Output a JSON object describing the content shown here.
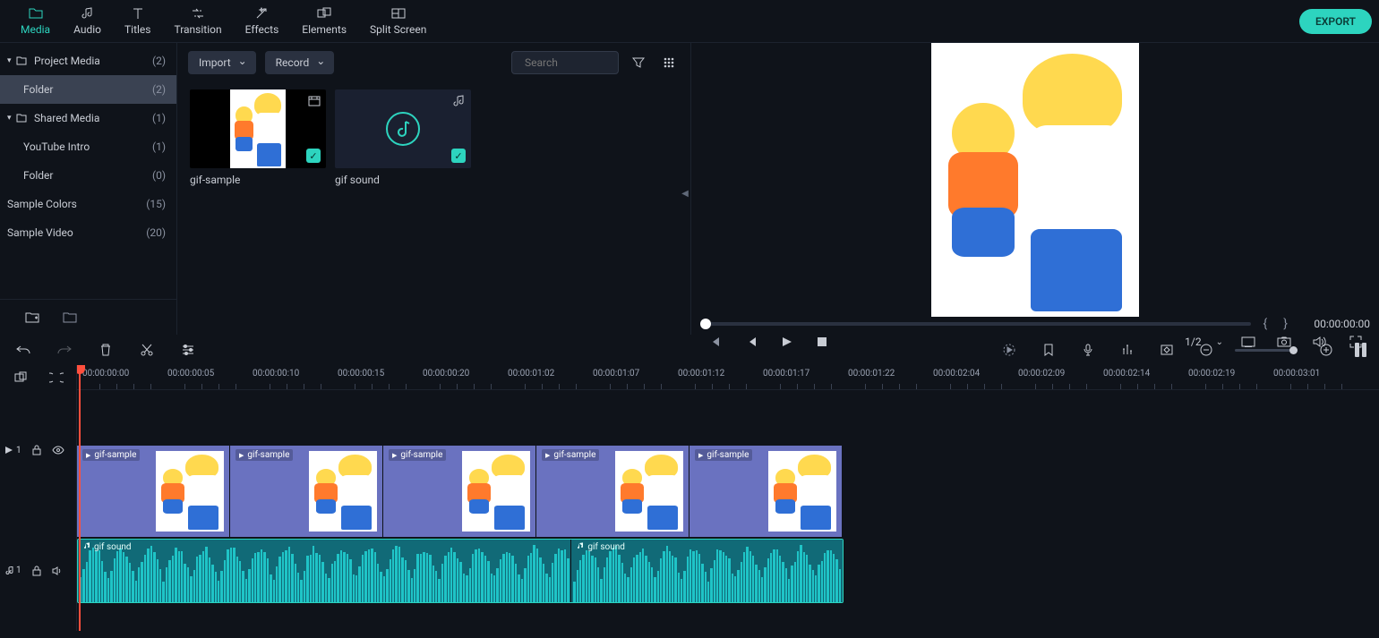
{
  "nav": {
    "items": [
      {
        "label": "Media",
        "icon": "media-icon"
      },
      {
        "label": "Audio",
        "icon": "audio-icon"
      },
      {
        "label": "Titles",
        "icon": "titles-icon"
      },
      {
        "label": "Transition",
        "icon": "transition-icon"
      },
      {
        "label": "Effects",
        "icon": "effects-icon"
      },
      {
        "label": "Elements",
        "icon": "elements-icon"
      },
      {
        "label": "Split Screen",
        "icon": "split-screen-icon"
      }
    ],
    "export_label": "EXPORT"
  },
  "library_tree": {
    "items": [
      {
        "label": "Project Media",
        "count": "(2)",
        "expandable": true
      },
      {
        "label": "Folder",
        "count": "(2)",
        "child": true,
        "selected": true
      },
      {
        "label": "Shared Media",
        "count": "(1)",
        "expandable": true
      },
      {
        "label": "YouTube Intro",
        "count": "(1)",
        "child": true
      },
      {
        "label": "Folder",
        "count": "(0)",
        "child": true
      },
      {
        "label": "Sample Colors",
        "count": "(15)"
      },
      {
        "label": "Sample Video",
        "count": "(20)"
      }
    ]
  },
  "media_bar": {
    "import_label": "Import",
    "record_label": "Record",
    "search_placeholder": "Search"
  },
  "media_items": [
    {
      "name": "gif-sample",
      "type": "video"
    },
    {
      "name": "gif sound",
      "type": "audio"
    }
  ],
  "preview": {
    "timecode": "00:00:00:00",
    "ratio": "1/2"
  },
  "ruler_ticks": [
    "00:00:00:00",
    "00:00:00:05",
    "00:00:00:10",
    "00:00:00:15",
    "00:00:00:20",
    "00:00:01:02",
    "00:00:01:07",
    "00:00:01:12",
    "00:00:01:17",
    "00:00:01:22",
    "00:00:02:04",
    "00:00:02:09",
    "00:00:02:14",
    "00:00:02:19",
    "00:00:03:01"
  ],
  "timeline": {
    "video_clip_label": "gif-sample",
    "audio_clip_label": "gif sound",
    "video_track_label": "1",
    "audio_track_label": "1"
  }
}
